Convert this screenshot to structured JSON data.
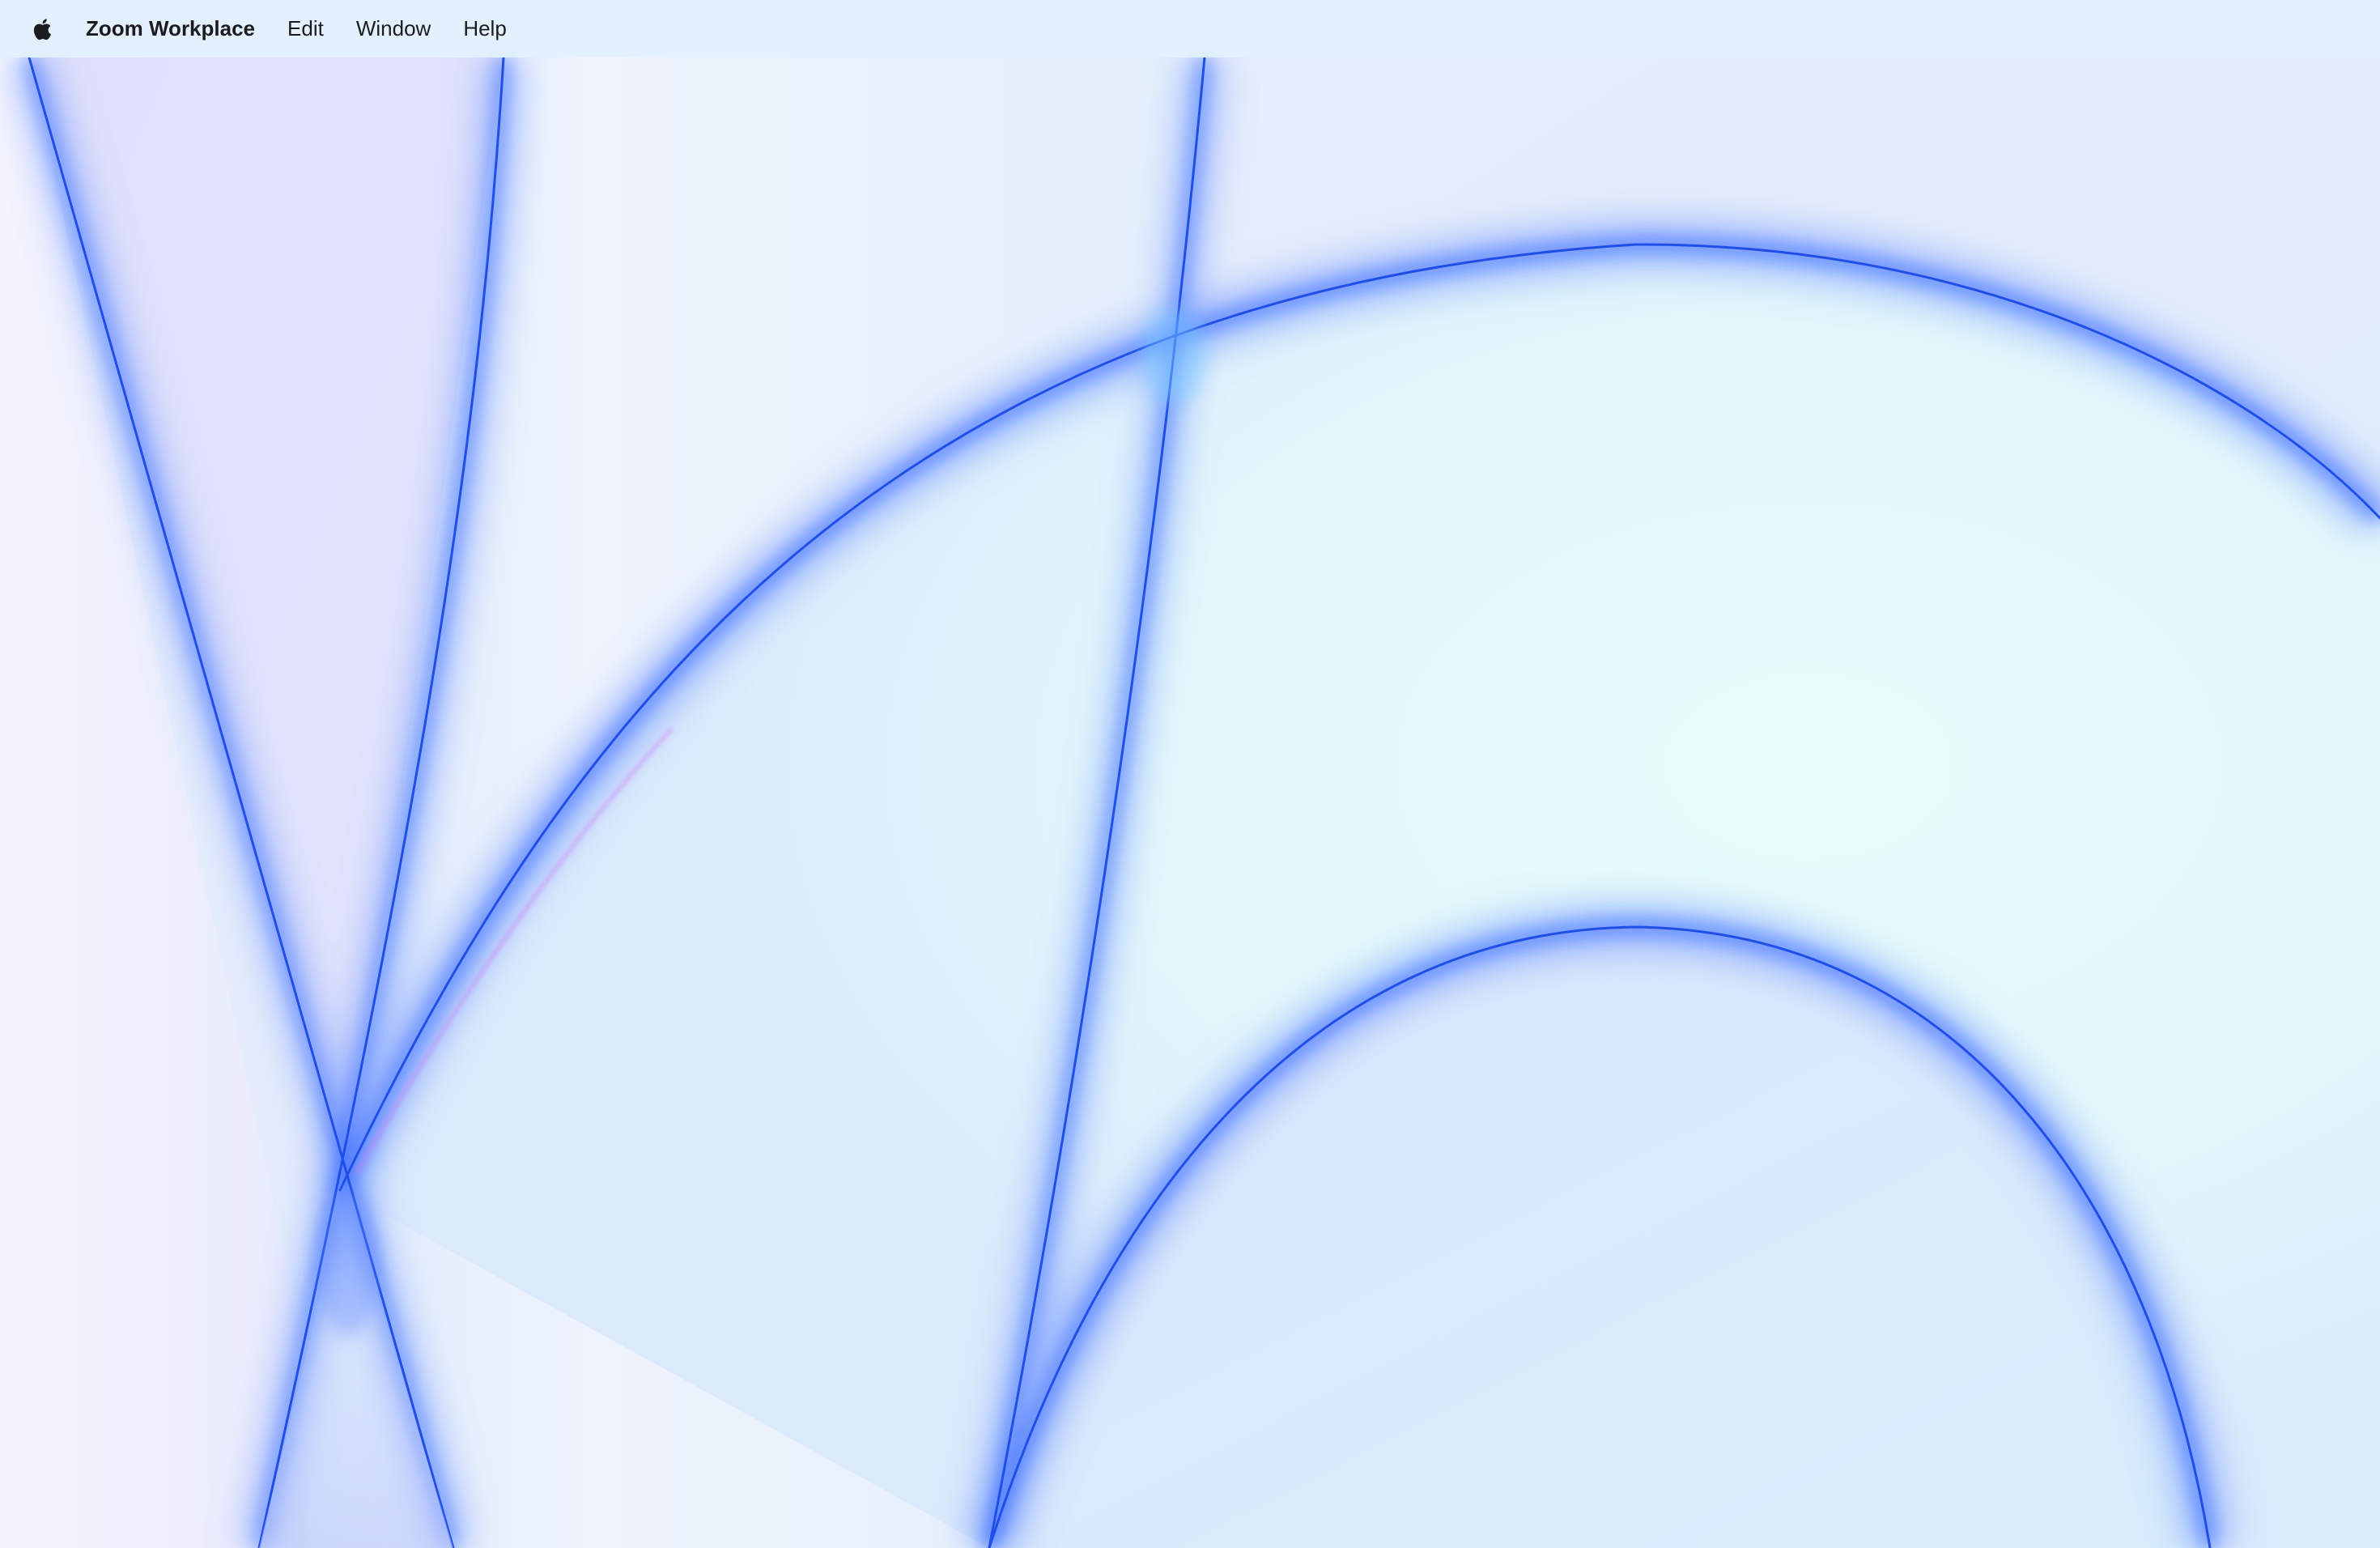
{
  "menubar": {
    "apple_icon": "apple-logo-icon",
    "app_name": "Zoom Workplace",
    "items": [
      {
        "label": "Edit"
      },
      {
        "label": "Window"
      },
      {
        "label": "Help"
      }
    ]
  },
  "wallpaper": {
    "description_colors": {
      "base": "#e4ecfb",
      "accent": "#1f5cf5",
      "glow": "#7fa8ff",
      "mint": "#e6fdfd",
      "lavender": "#dfe0fb"
    }
  }
}
